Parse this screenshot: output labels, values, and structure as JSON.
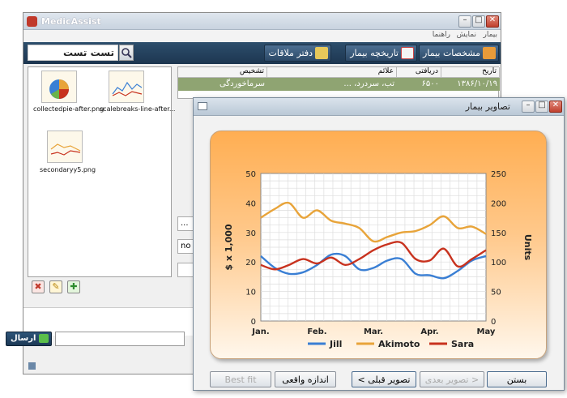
{
  "app": {
    "title": "MedicAssist"
  },
  "menu": [
    "بیمار",
    "نمایش",
    "راهنما"
  ],
  "search": {
    "value": "تست تست"
  },
  "toolbar": {
    "patient_info": "مشخصات بیمار",
    "patient_history": "تاریخچه بیمار",
    "appointments": "دفتر ملاقات"
  },
  "thumbnails": [
    {
      "label": "collectedpie-after.png"
    },
    {
      "label": "scalebreaks-line-after..."
    },
    {
      "label": "secondaryy5.png"
    }
  ],
  "table": {
    "headers": [
      "تاریخ",
      "دریافتی",
      "علائم",
      "تشخیص"
    ],
    "row": [
      "۱۳۸۶/۱۰/۱۹",
      "۶۵۰۰",
      "تب، سردرد، ...",
      "سرماخوردگی"
    ]
  },
  "fields": {
    "field_1": "...",
    "field_2": "no"
  },
  "send_button": "ارسال",
  "dialog": {
    "title": "تصاویر بیمار",
    "buttons": {
      "close": "بستن",
      "prev": "تصویر قبلی >",
      "next": "< تصویر بعدی",
      "actual_size": "اندازه واقعی",
      "best_fit": "Best fit"
    }
  },
  "chart_data": {
    "type": "line",
    "title": "",
    "ylabel": "$ x 1,000",
    "y2label": "Units",
    "categories": [
      "Jan.",
      "Feb.",
      "Mar.",
      "Apr.",
      "May"
    ],
    "ylim": [
      0,
      50
    ],
    "y2lim": [
      0,
      250
    ],
    "yticks": [
      0,
      10,
      20,
      30,
      40,
      50
    ],
    "y2ticks": [
      0,
      50,
      100,
      150,
      200,
      250
    ],
    "series": [
      {
        "name": "Jill",
        "color": "#3a7fd4",
        "x": [
          0,
          0.25,
          0.5,
          0.75,
          1,
          1.25,
          1.5,
          1.75,
          2,
          2.25,
          2.5,
          2.75,
          3,
          3.25,
          3.5,
          3.75,
          4
        ],
        "values": [
          22,
          18,
          16,
          16.5,
          19,
          22.5,
          22,
          17.5,
          18,
          20.5,
          21,
          16,
          15.5,
          14.5,
          17,
          20.5,
          22
        ]
      },
      {
        "name": "Akimoto",
        "color": "#e8a43a",
        "x": [
          0,
          0.25,
          0.5,
          0.75,
          1,
          1.25,
          1.5,
          1.75,
          2,
          2.25,
          2.5,
          2.75,
          3,
          3.25,
          3.5,
          3.75,
          4
        ],
        "values": [
          35,
          38,
          40,
          35,
          37.5,
          34,
          33,
          31.5,
          27,
          28.5,
          30,
          30.5,
          32.5,
          35.5,
          31.5,
          32,
          29.5
        ]
      },
      {
        "name": "Sara",
        "color": "#c8321e",
        "x": [
          0,
          0.25,
          0.5,
          0.75,
          1,
          1.25,
          1.5,
          1.75,
          2,
          2.25,
          2.5,
          2.75,
          3,
          3.25,
          3.5,
          3.75,
          4
        ],
        "values": [
          19,
          17.5,
          19,
          21,
          19.5,
          21.5,
          19,
          21,
          24,
          26,
          26.5,
          21,
          20.5,
          24.5,
          18.5,
          21,
          24
        ]
      }
    ],
    "grid": true,
    "legend": "bottom"
  }
}
